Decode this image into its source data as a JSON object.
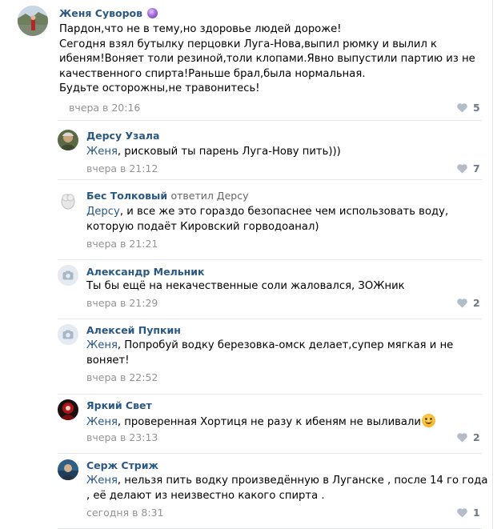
{
  "comments": [
    {
      "author": "Женя Суворов",
      "text_lines": [
        "Пардон,что не в тему,но здоровье людей дороже!",
        "Сегодня взял бутылку перцовки Луга-Нова,выпил рюмку и вылил к",
        "ибеням!Воняет толи резиной,толи клопами.Явно выпустили партию из не",
        "качественного спирта!Раньше брал,была нормальная.",
        "Будьте осторожны,не травонитесь!"
      ],
      "date": "вчера в 20:16",
      "likes": "5",
      "badge_icon": "crystal-ball-icon"
    },
    {
      "author": "Дерсу Узала",
      "mention": "Женя",
      "text_lines": [
        ", рисковый ты парень Луга-Нову пить)))"
      ],
      "date": "вчера в 21:12",
      "likes": "7"
    },
    {
      "author": "Бес Толковый",
      "reply_label": "ответил Дерсу",
      "mention": "Дерсу",
      "text_lines": [
        ", и все же это гораздо безопаснее чем использовать воду,",
        "которую подаёт Кировский горводоанал)"
      ],
      "date": "вчера в 21:21",
      "likes": ""
    },
    {
      "author": "Александр Мельник",
      "text_lines": [
        "Ты бы ещё на некачественные соли жаловался, ЗОЖник"
      ],
      "date": "вчера в 21:29",
      "likes": "2",
      "avatar_icon": "camera-icon"
    },
    {
      "author": "Алексей Пупкин",
      "mention": "Женя",
      "text_lines": [
        ", Попробуй водку березовка-омск делает,супер мягкая и не",
        "воняет!"
      ],
      "date": "вчера в 22:52",
      "likes": "",
      "avatar_icon": "camera-icon"
    },
    {
      "author": "Яркий Свет",
      "mention": "Женя",
      "text_lines": [
        ", проверенная Хортиця не разу к ибеням не выливали"
      ],
      "emoji": "smiling-face-icon",
      "date": "вчера в 23:13",
      "likes": "2"
    },
    {
      "author": "Серж Стриж",
      "mention": "Женя",
      "text_lines": [
        ", нельзя пить водку произведённую в Луганске , после 14 го года",
        ", её делают из неизвестно какого спирта ."
      ],
      "date": "сегодня в 8:31",
      "likes": "1"
    }
  ],
  "colors": {
    "author": "#2a5885",
    "date": "#939393",
    "like": "#6f7985",
    "divider": "#e7e8ec"
  },
  "icons": {
    "like": "heart-icon"
  }
}
